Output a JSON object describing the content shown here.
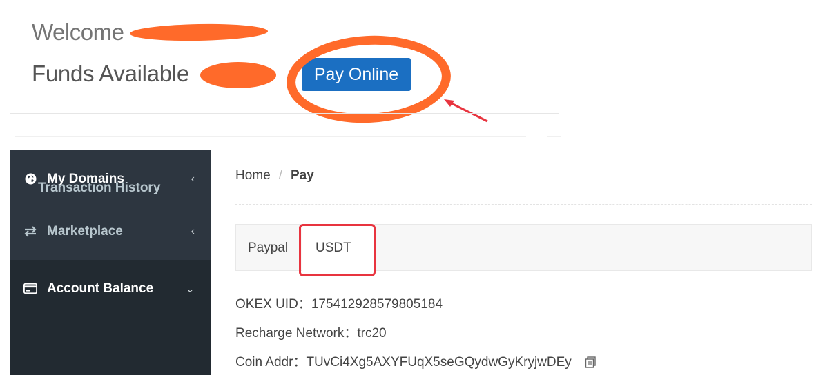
{
  "header": {
    "welcome_label": "Welcome",
    "funds_label": "Funds Available",
    "pay_online_button": "Pay Online"
  },
  "sidebar": {
    "items": [
      {
        "label": "My Domains",
        "icon": "globe-icon",
        "expanded": false
      },
      {
        "label": "Marketplace",
        "icon": "exchange-arrows-icon",
        "expanded": false
      },
      {
        "label": "Account Balance",
        "icon": "credit-card-icon",
        "expanded": true,
        "children": [
          {
            "label": "Transaction History"
          }
        ]
      }
    ]
  },
  "breadcrumb": {
    "home": "Home",
    "separator": "/",
    "current": "Pay"
  },
  "tabs": [
    {
      "label": "Paypal",
      "active": false
    },
    {
      "label": "USDT",
      "active": true
    }
  ],
  "usdt_info": {
    "uid_label": "OKEX UID：",
    "uid_value": "175412928579805184",
    "network_label": "Recharge Network：",
    "network_value": "trc20",
    "addr_label": "Coin Addr：",
    "addr_value": "TUvCi4Xg5AXYFUqX5seGQydwGyKryjwDEy"
  },
  "colors": {
    "sidebar_bg": "#2d3640",
    "pay_button": "#1b6fc2",
    "annotation_orange": "#ff6a2a",
    "annotation_red": "#e8343f"
  }
}
